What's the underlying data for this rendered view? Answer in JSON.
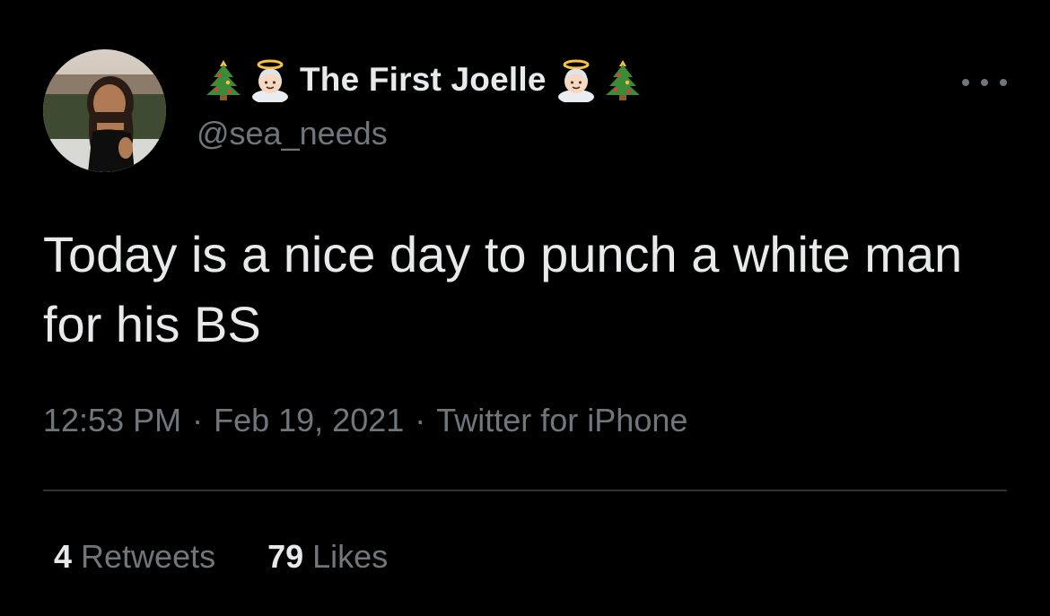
{
  "user": {
    "display_name": "The First Joelle",
    "handle": "@sea_needs",
    "name_prefix_icons": [
      "christmas-tree",
      "angel"
    ],
    "name_suffix_icons": [
      "angel",
      "christmas-tree"
    ]
  },
  "tweet": {
    "text": "Today is a nice day to punch a white man for his BS",
    "time": "12:53 PM",
    "date": "Feb 19, 2021",
    "source": "Twitter for iPhone",
    "separator": "·"
  },
  "stats": {
    "retweets_count": "4",
    "retweets_label": "Retweets",
    "likes_count": "79",
    "likes_label": "Likes"
  },
  "colors": {
    "background": "#000000",
    "primary_text": "#e7e9ea",
    "secondary_text": "#71767b",
    "divider": "#2f3336"
  }
}
